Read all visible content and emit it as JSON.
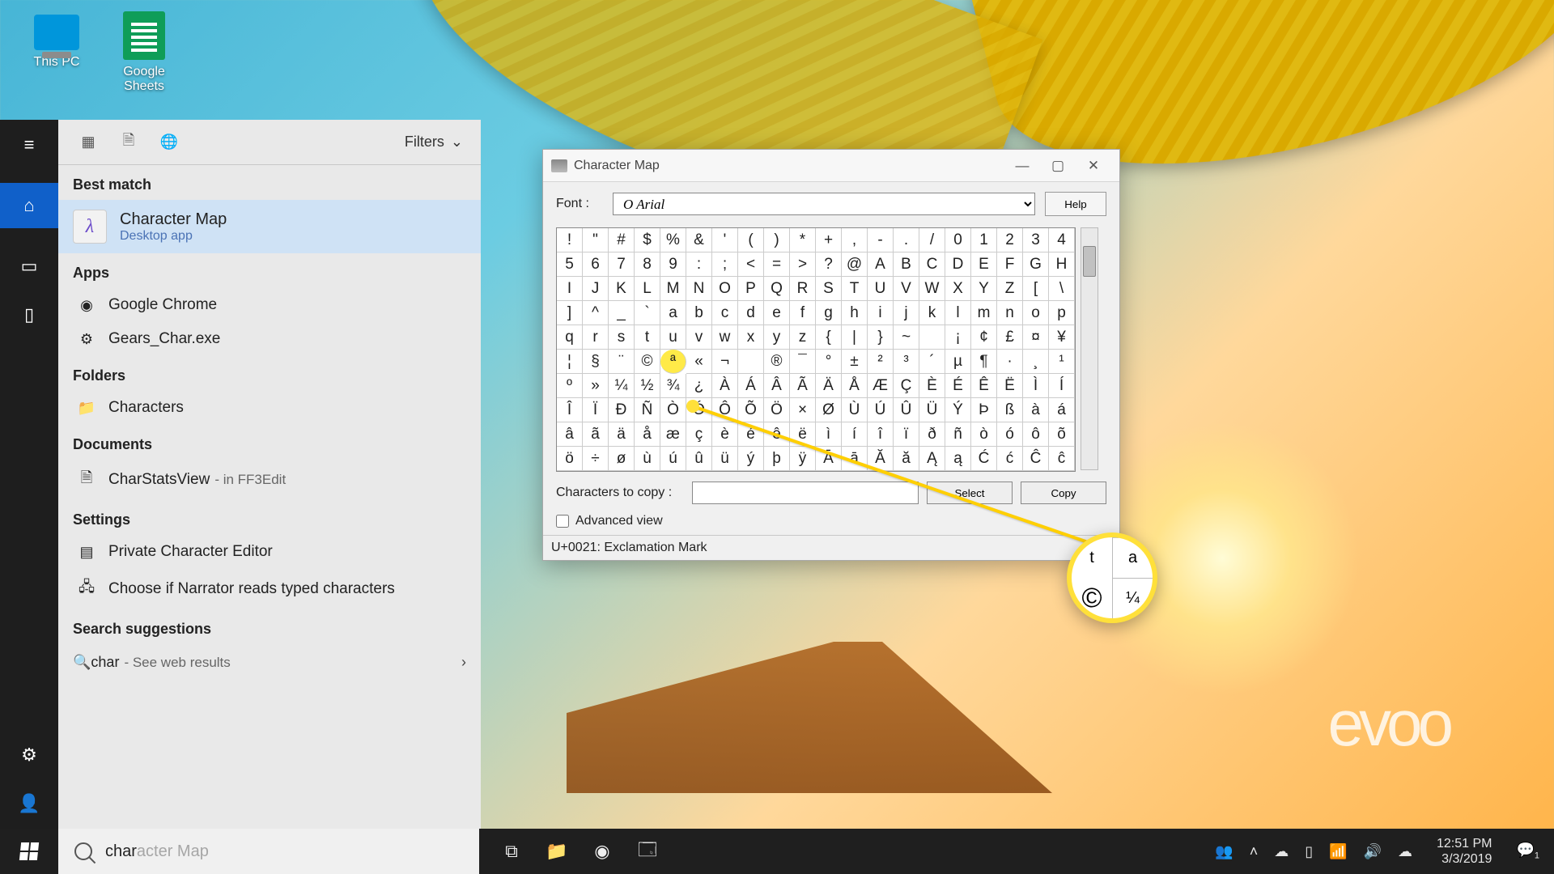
{
  "desktop": {
    "icons": [
      {
        "name": "This PC"
      },
      {
        "name": "Google Sheets"
      }
    ]
  },
  "watermark": "evoo",
  "taskbar": {
    "search_typed": "char",
    "search_ghost": "acter Map",
    "clock_time": "12:51 PM",
    "clock_date": "3/3/2019",
    "notif_count": "1"
  },
  "panel": {
    "filters_label": "Filters",
    "best_match_label": "Best match",
    "best_match": {
      "title": "Character Map",
      "subtitle": "Desktop app"
    },
    "apps_label": "Apps",
    "apps": [
      {
        "label": "Google Chrome"
      },
      {
        "label": "Gears_Char.exe"
      }
    ],
    "folders_label": "Folders",
    "folders": [
      {
        "label": "Characters"
      }
    ],
    "documents_label": "Documents",
    "documents": [
      {
        "label": "CharStatsView",
        "sub": "- in FF3Edit"
      }
    ],
    "settings_label": "Settings",
    "settings": [
      {
        "label": "Private Character Editor"
      },
      {
        "label": "Choose if Narrator reads typed characters"
      }
    ],
    "suggest_label": "Search suggestions",
    "suggest": {
      "q": "char",
      "sub": "- See web results"
    }
  },
  "charmap": {
    "title": "Character Map",
    "font_label": "Font :",
    "font_value": "O Arial",
    "help": "Help",
    "chars_row1": [
      "!",
      "\"",
      "#",
      "$",
      "%",
      "&",
      "'",
      "(",
      ")",
      "*",
      "+",
      ",",
      "-",
      ".",
      "/",
      "0",
      "1",
      "2",
      "3",
      "4"
    ],
    "chars_row2": [
      "5",
      "6",
      "7",
      "8",
      "9",
      ":",
      ";",
      "<",
      "=",
      ">",
      "?",
      "@",
      "A",
      "B",
      "C",
      "D",
      "E",
      "F",
      "G",
      "H"
    ],
    "chars_row3": [
      "I",
      "J",
      "K",
      "L",
      "M",
      "N",
      "O",
      "P",
      "Q",
      "R",
      "S",
      "T",
      "U",
      "V",
      "W",
      "X",
      "Y",
      "Z",
      "[",
      "\\"
    ],
    "chars_row4": [
      "]",
      "^",
      "_",
      "`",
      "a",
      "b",
      "c",
      "d",
      "e",
      "f",
      "g",
      "h",
      "i",
      "j",
      "k",
      "l",
      "m",
      "n",
      "o",
      "p"
    ],
    "chars_row5": [
      "q",
      "r",
      "s",
      "t",
      "u",
      "v",
      "w",
      "x",
      "y",
      "z",
      "{",
      "|",
      "}",
      "~",
      " ",
      "¡",
      "¢",
      "£",
      "¤",
      "¥"
    ],
    "chars_row6": [
      "¦",
      "§",
      "¨",
      "©",
      "ª",
      "«",
      "¬",
      " ",
      "®",
      "¯",
      "°",
      "±",
      "²",
      "³",
      "´",
      "µ",
      "¶",
      "·",
      "¸",
      "¹"
    ],
    "chars_row7": [
      "º",
      "»",
      "¼",
      "½",
      "¾",
      "¿",
      "À",
      "Á",
      "Â",
      "Ã",
      "Ä",
      "Å",
      "Æ",
      "Ç",
      "È",
      "É",
      "Ê",
      "Ë",
      "Ì",
      "Í"
    ],
    "chars_row8": [
      "Î",
      "Ï",
      "Ð",
      "Ñ",
      "Ò",
      "Ó",
      "Ô",
      "Õ",
      "Ö",
      "×",
      "Ø",
      "Ù",
      "Ú",
      "Û",
      "Ü",
      "Ý",
      "Þ",
      "ß",
      "à",
      "á"
    ],
    "chars_row9": [
      "â",
      "ã",
      "ä",
      "å",
      "æ",
      "ç",
      "è",
      "é",
      "ê",
      "ë",
      "ì",
      "í",
      "î",
      "ï",
      "ð",
      "ñ",
      "ò",
      "ó",
      "ô",
      "õ"
    ],
    "chars_row10": [
      "ö",
      "÷",
      "ø",
      "ù",
      "ú",
      "û",
      "ü",
      "ý",
      "þ",
      "ÿ",
      "Ā",
      "ā",
      "Ă",
      "ă",
      "Ą",
      "ą",
      "Ć",
      "ć",
      "Ĉ",
      "ĉ"
    ],
    "highlight_index": 104,
    "copy_label": "Characters to copy :",
    "copy_value": "",
    "select": "Select",
    "copy": "Copy",
    "advanced": "Advanced view",
    "status": "U+0021: Exclamation Mark"
  },
  "callout": {
    "tl": "t",
    "tr": "a",
    "bl": "©",
    "br": "¼"
  }
}
